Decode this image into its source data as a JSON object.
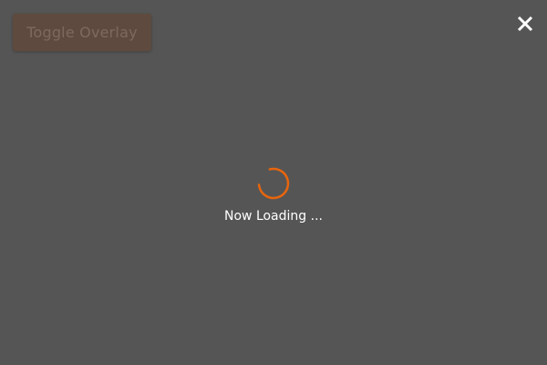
{
  "toolbar": {
    "toggle_overlay_label": "Toggle Overlay"
  },
  "overlay": {
    "close_icon": "close-icon",
    "loading_icon": "spinner-icon",
    "loading_text": "Now Loading ..."
  },
  "colors": {
    "overlay_background": "#555555",
    "spinner_accent": "#e8650d",
    "button_background": "#5e4a3e",
    "button_text": "#7d6a5e",
    "loading_text": "#ffffff",
    "close_icon": "#ffffff"
  }
}
